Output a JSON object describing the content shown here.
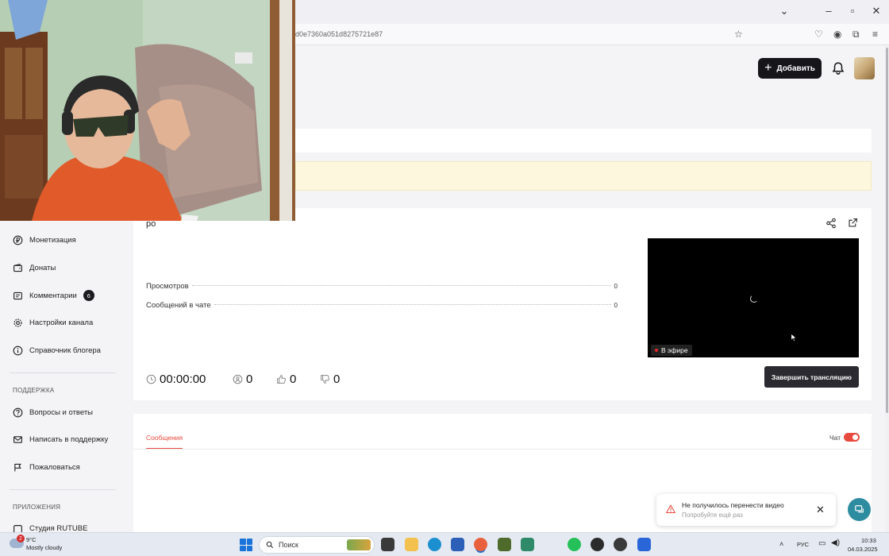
{
  "browser": {
    "url_fragment": "d0e7360a051d8275721e87"
  },
  "header": {
    "add_button_label": "Добавить"
  },
  "sidebar": {
    "items": [
      {
        "label": "Монетизация",
        "icon": "ruble-icon"
      },
      {
        "label": "Донаты",
        "icon": "wallet-icon"
      },
      {
        "label": "Комментарии",
        "icon": "comment-icon",
        "badge": "6"
      },
      {
        "label": "Настройки канала",
        "icon": "gear-icon"
      },
      {
        "label": "Справочник блогера",
        "icon": "info-icon"
      }
    ],
    "support_title": "ПОДДЕРЖКА",
    "support_items": [
      {
        "label": "Вопросы и ответы",
        "icon": "question-icon"
      },
      {
        "label": "Написать в поддержку",
        "icon": "mail-icon"
      },
      {
        "label": "Пожаловаться",
        "icon": "flag-icon"
      }
    ],
    "apps_title": "ПРИЛОЖЕНИЯ",
    "apps_items": [
      {
        "label": "Студия RUTUBE"
      }
    ]
  },
  "stream": {
    "name_partial": "ро",
    "stats": [
      {
        "label": "Просмотров",
        "value": "0"
      },
      {
        "label": "Сообщений в чате",
        "value": "0"
      }
    ],
    "live_label": "В эфире",
    "timer": "00:00:00",
    "viewers": "0",
    "likes": "0",
    "dislikes": "0",
    "end_button": "Завершить трансляцию"
  },
  "messages": {
    "tab_label": "Сообщения",
    "chat_label": "Чат",
    "chat_enabled": true
  },
  "toast": {
    "title": "Не получилось перенести видео",
    "subtitle": "Попробуйте ещё раз"
  },
  "taskbar": {
    "weather_badge": "2",
    "temperature": "9°C",
    "weather_text": "Mostly cloudy",
    "search_placeholder": "Поиск",
    "language": "РУС",
    "time": "10:33",
    "date": "04.03.2025"
  },
  "colors": {
    "accent": "#e94a3f",
    "dark_button": "#15151a",
    "warning_bg": "#fdf8dd"
  }
}
